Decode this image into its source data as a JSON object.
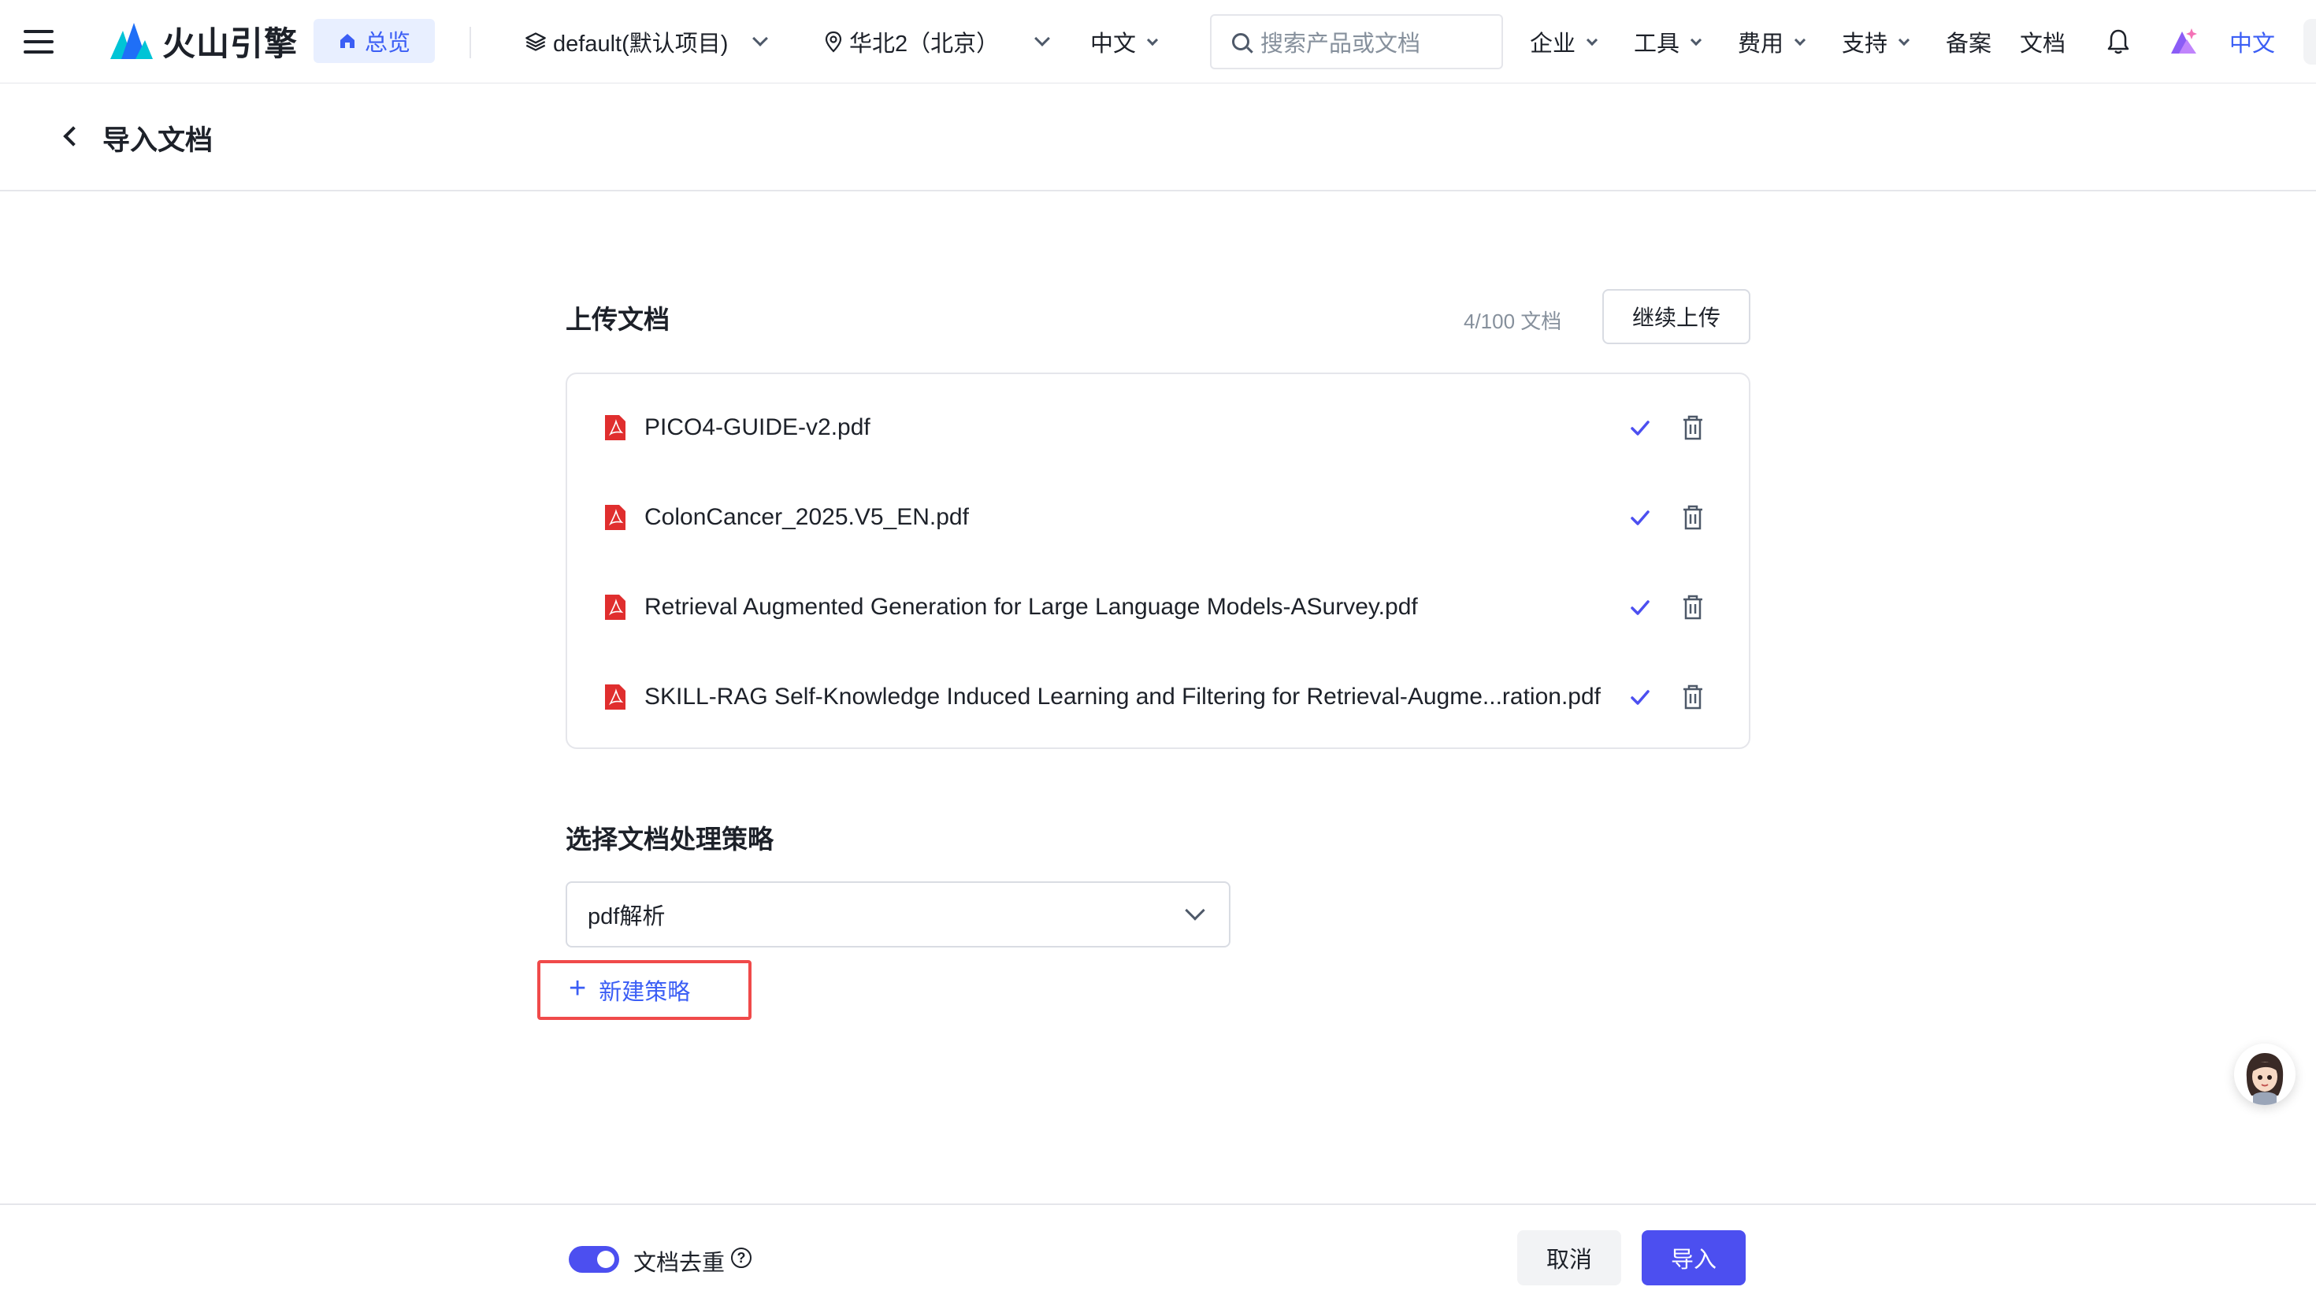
{
  "nav": {
    "logo_text": "火山引擎",
    "overview_label": "总览",
    "project_label": "default(默认项目)",
    "region_label": "华北2（北京）",
    "language_label": "中文",
    "search_placeholder": "搜索产品或文档",
    "items": [
      {
        "label": "企业"
      },
      {
        "label": "工具"
      },
      {
        "label": "费用"
      },
      {
        "label": "支持"
      }
    ],
    "filing_label": "备案",
    "docs_label": "文档",
    "lang_link": "中文"
  },
  "header": {
    "title": "导入文档"
  },
  "upload": {
    "title": "上传文档",
    "count": "4/100 文档",
    "upload_more_label": "继续上传",
    "files": [
      {
        "name": "PICO4-GUIDE-v2.pdf"
      },
      {
        "name": "ColonCancer_2025.V5_EN.pdf"
      },
      {
        "name": "Retrieval Augmented Generation for Large Language Models-ASurvey.pdf"
      },
      {
        "name": "SKILL-RAG Self-Knowledge Induced Learning and Filtering for Retrieval-Augme...ration.pdf"
      }
    ]
  },
  "strategy": {
    "title": "选择文档处理策略",
    "selected": "pdf解析",
    "new_label": "新建策略"
  },
  "footer": {
    "dedup_label": "文档去重",
    "dedup_enabled": true,
    "cancel_label": "取消",
    "import_label": "导入"
  },
  "colors": {
    "accent": "#4c4ff0",
    "link": "#3b5ef5",
    "highlight_border": "#f04a4a",
    "pdf_red": "#e02e2e"
  }
}
